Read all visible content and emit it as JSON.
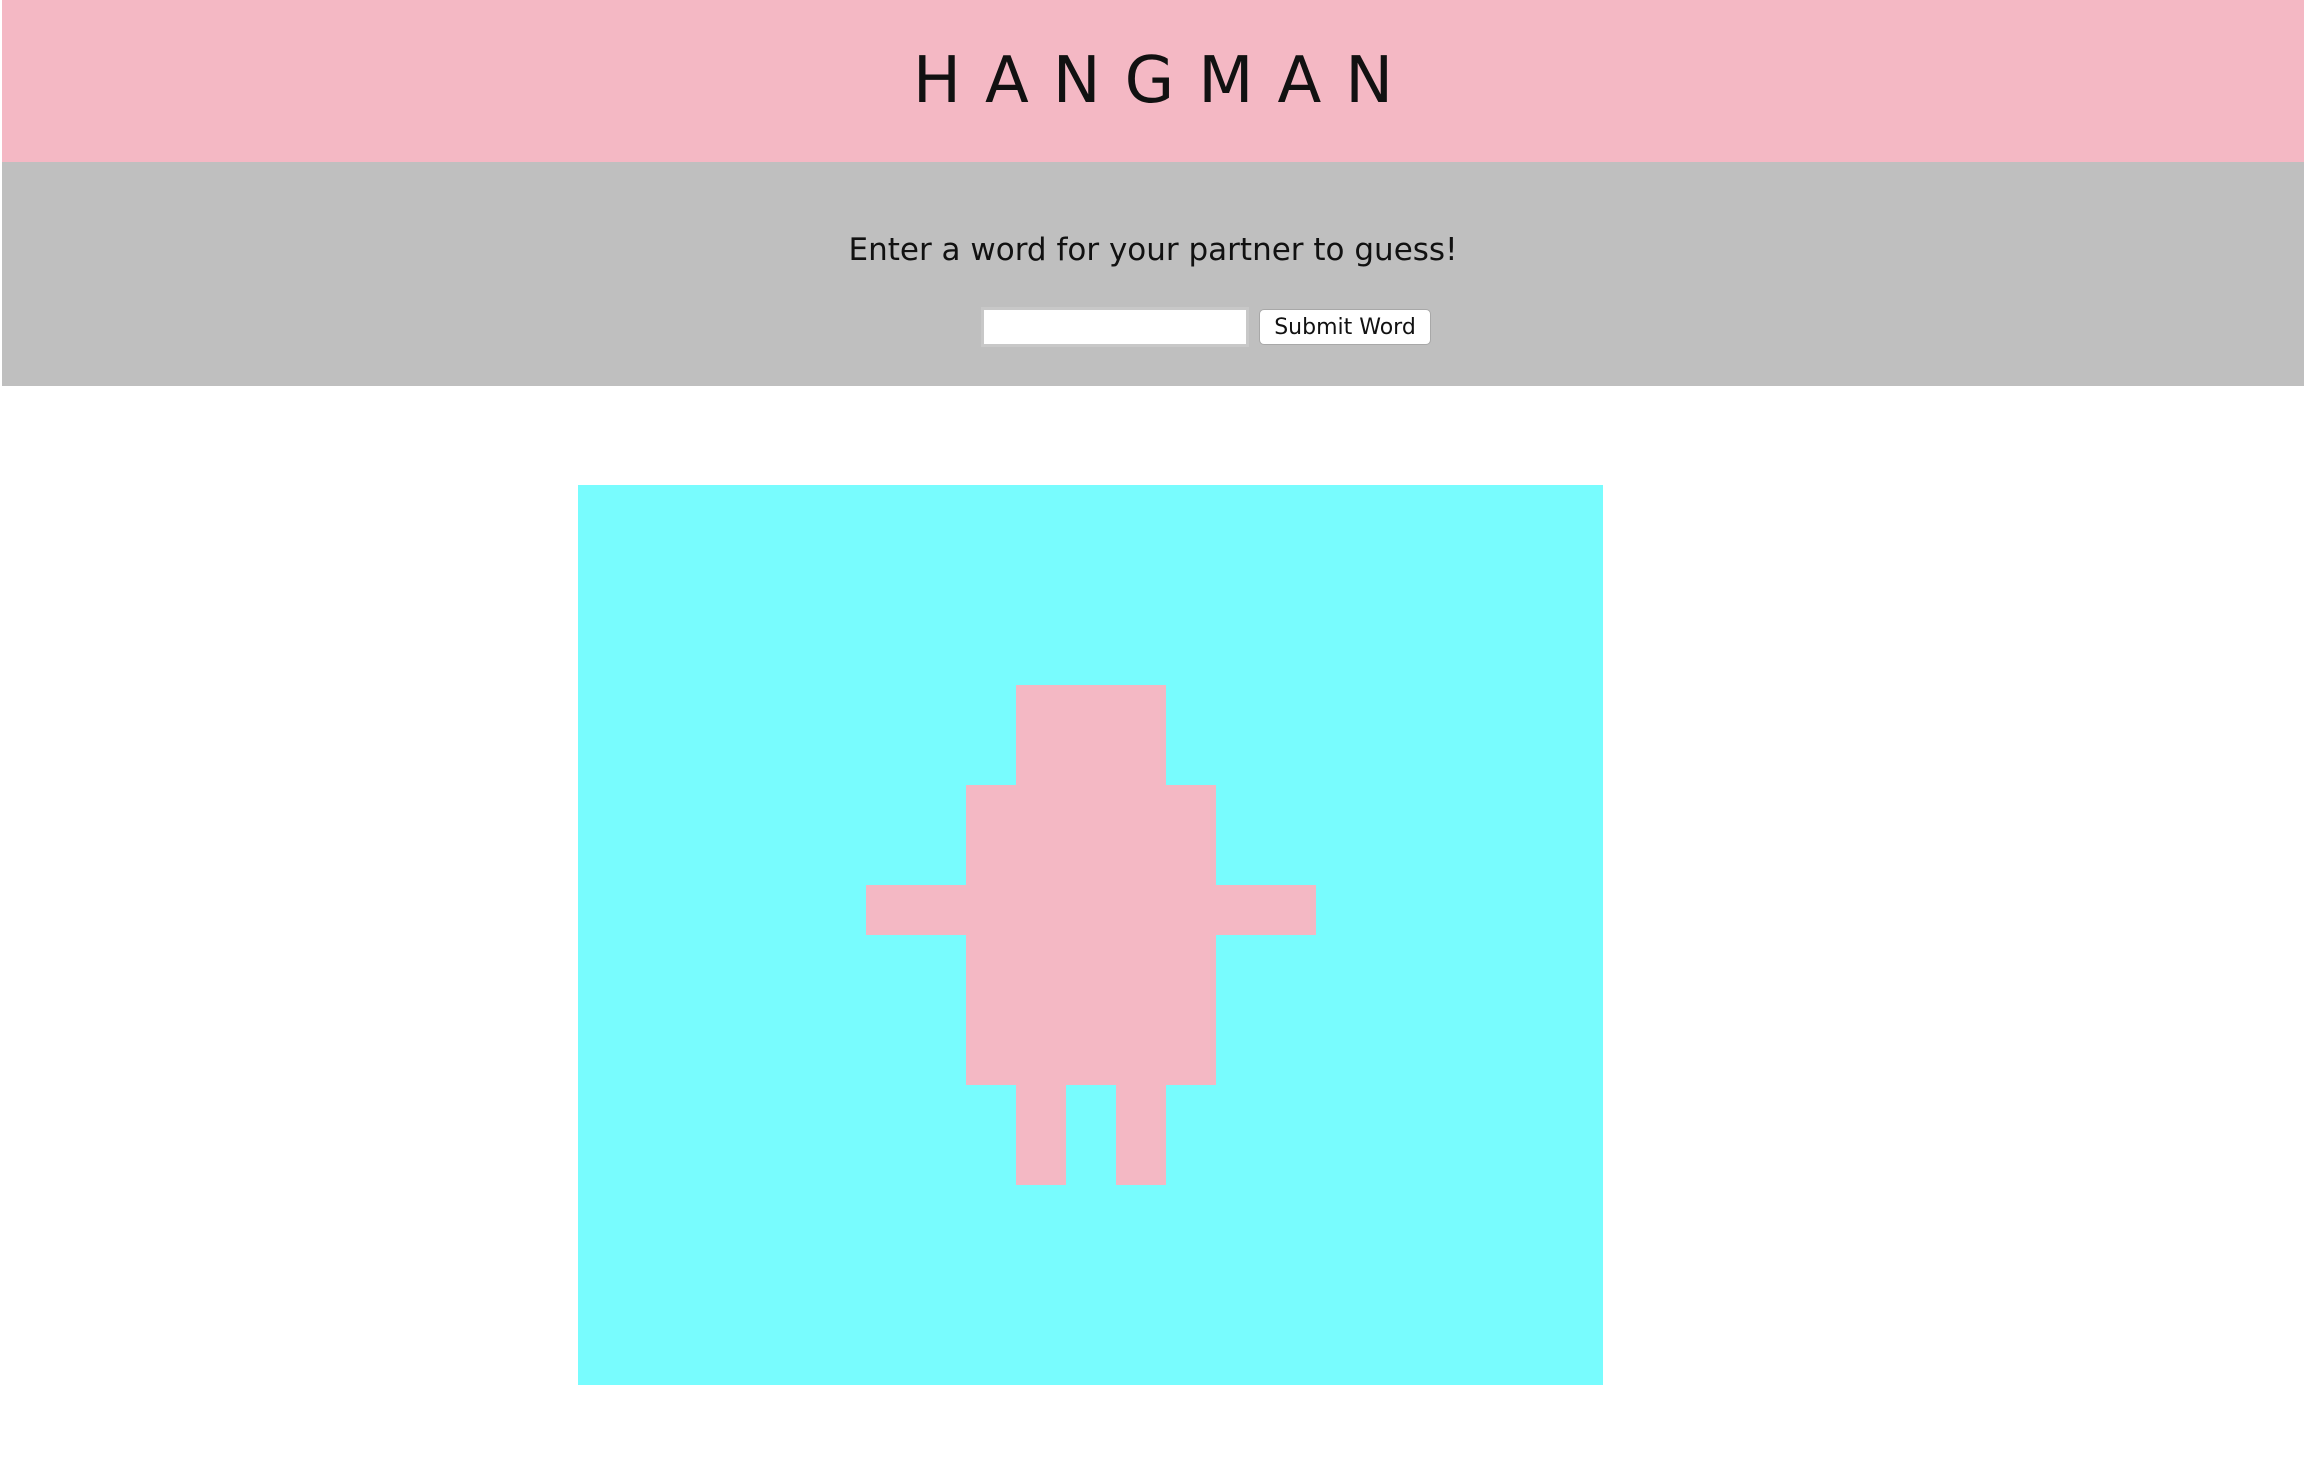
{
  "header": {
    "title": "HANGMAN"
  },
  "word_entry": {
    "prompt": "Enter a word for your partner to guess!",
    "input_value": "",
    "submit_label": "Submit Word"
  },
  "hangman": {
    "parts_shown": [
      "head",
      "body",
      "left-arm",
      "right-arm",
      "left-leg",
      "right-leg"
    ]
  },
  "colors": {
    "header_bg": "#f4b8c4",
    "panel_bg": "#bfbfbf",
    "canvas_bg": "#78fcfe",
    "figure": "#f4b8c4"
  }
}
